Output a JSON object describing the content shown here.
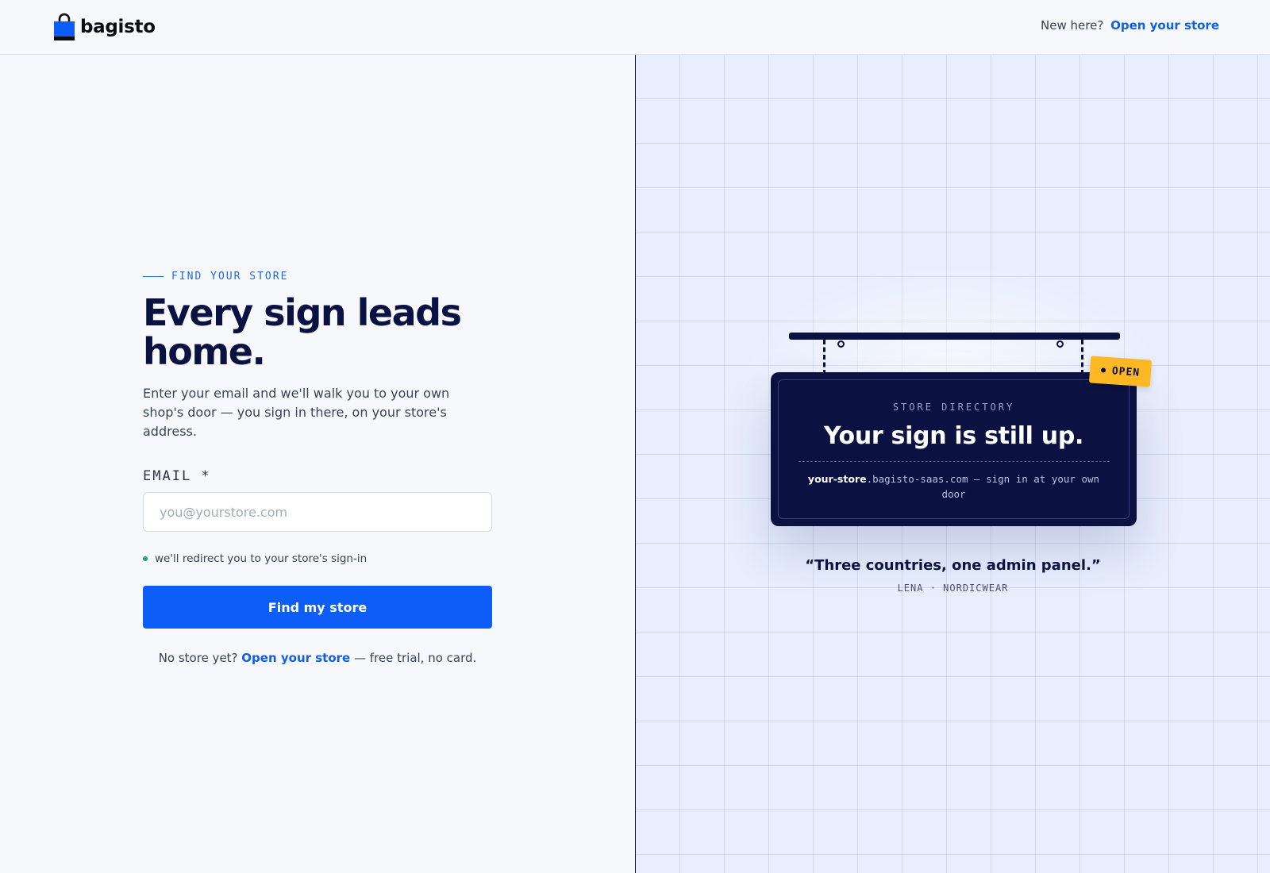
{
  "header": {
    "brand": "bagisto",
    "new_here": "New here?",
    "open_store_link": "Open your store"
  },
  "form": {
    "eyebrow": "FIND YOUR STORE",
    "title": "Every sign leads home.",
    "lead": "Enter your email and we'll walk you to your own shop's door — you sign in there, on your store's address.",
    "email_label": "EMAIL *",
    "email_value": "",
    "email_placeholder": "you@yourstore.com",
    "hint": "we'll redirect you to your store's sign-in",
    "cta": "Find my store",
    "footer_prefix": "No store yet?",
    "footer_link": "Open your store",
    "footer_suffix": "— free trial, no card."
  },
  "illustration": {
    "kicker": "STORE DIRECTORY",
    "sign_title": "Your sign is still up.",
    "url_store": "your-store",
    "url_rest": ".bagisto-saas.com — sign in at your own door",
    "open_tag": "OPEN",
    "quote": "“Three countries, one admin panel.”",
    "attribution": "LENA · NORDICWEAR"
  },
  "colors": {
    "accent": "#0d5ef8",
    "navy": "#0b1140",
    "tag": "#ffb823",
    "status_dot": "#1fa36a"
  },
  "icons": {
    "logo": "shopping-bag-icon"
  }
}
